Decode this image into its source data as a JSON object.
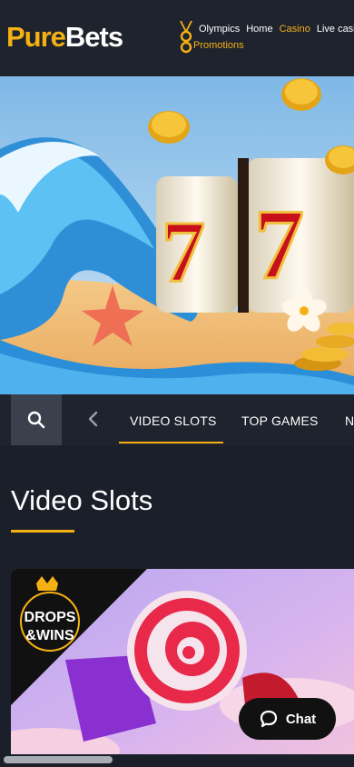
{
  "header": {
    "logo_part1": "Pure",
    "logo_part2": "Bets",
    "nav": [
      "Olympics",
      "Home",
      "Casino",
      "Live casino"
    ],
    "active_nav": "Casino",
    "promotions": "Promotions",
    "olympic_icon": "olympic-medal-icon"
  },
  "categories": {
    "search_icon": "search-icon",
    "prev_icon": "chevron-left-icon",
    "items": [
      "VIDEO SLOTS",
      "TOP GAMES",
      "N"
    ],
    "active": "VIDEO SLOTS"
  },
  "main": {
    "title": "Video Slots"
  },
  "card": {
    "badge_line1": "DROPS",
    "badge_line2": "&WINS"
  },
  "chat": {
    "label": "Chat",
    "icon": "chat-bubble-icon"
  },
  "colors": {
    "accent": "#f5b114",
    "background": "#1a1f29",
    "header": "#1e232d"
  }
}
